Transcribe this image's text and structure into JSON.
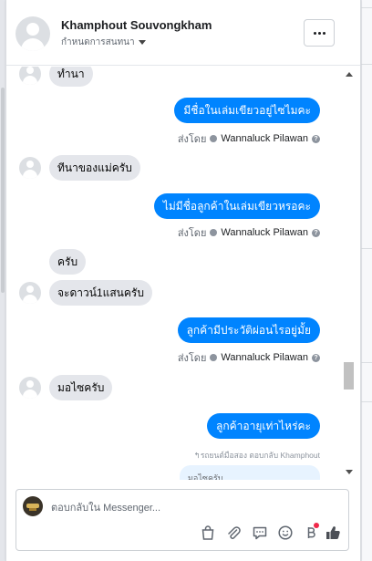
{
  "colors": {
    "accent": "#0084ff",
    "incoming_bubble": "#e4e6eb",
    "muted": "#606770"
  },
  "header": {
    "contact_name": "Khamphout Souvongkham",
    "subtitle": "กำหนดการสนทนา",
    "more_icon": "more-dots-icon"
  },
  "messages": [
    {
      "direction": "in",
      "text": "ทำนา",
      "avatar": false
    },
    {
      "direction": "out",
      "text": "มีชื่อในเล่มเขียวอยู่ไซไมคะ",
      "sent_by_label": "ส่งโดย",
      "sender": "Wannaluck Pilawan"
    },
    {
      "direction": "in",
      "text": "ทีนาของแม่ครับ",
      "avatar": true
    },
    {
      "direction": "out",
      "text": "ไม่มีชื่อลูกค้าในเล่มเขียวหรอคะ",
      "sent_by_label": "ส่งโดย",
      "sender": "Wannaluck Pilawan"
    },
    {
      "direction": "in",
      "text": "ครับ",
      "avatar": false
    },
    {
      "direction": "in",
      "text": "จะดาวน์1แสนครับ",
      "avatar": true
    },
    {
      "direction": "out",
      "text": "ลูกค้ามีประวัติผ่อนไรอยู่มั้ย",
      "sent_by_label": "ส่งโดย",
      "sender": "Wannaluck Pilawan"
    },
    {
      "direction": "in",
      "text": "มอไซครับ",
      "avatar": true
    },
    {
      "direction": "out",
      "text": "ลูกค้าอายุเท่าไหร่คะ"
    }
  ],
  "reply_note": "↰รถยนต์มือสอง ตอบกลับ Khamphout",
  "quoted_text": "มอไซครับ",
  "composer": {
    "placeholder": "ตอบกลับใน Messenger...",
    "value": "",
    "tools": [
      "bag-icon",
      "paperclip-icon",
      "speech-bubble-icon",
      "smiley-icon",
      "currency-icon",
      "thumbs-up-icon"
    ]
  }
}
